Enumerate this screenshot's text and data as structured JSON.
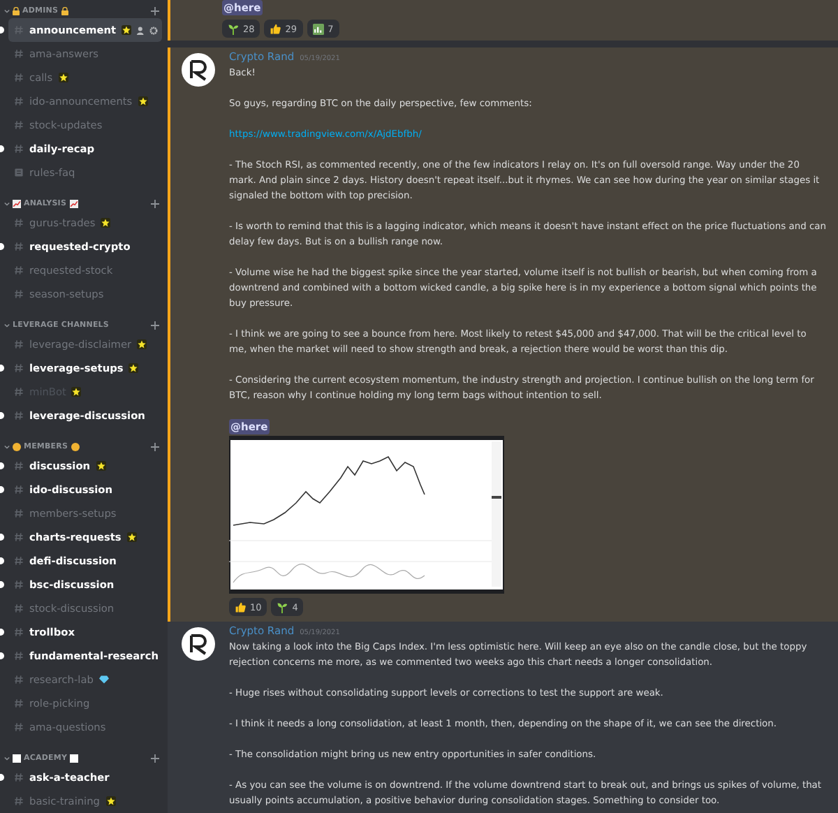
{
  "sidebar": {
    "categories": [
      {
        "name": "ADMINS",
        "kind": "lock",
        "expanded": true,
        "channels": [
          {
            "name": "announcement",
            "kind": "text",
            "unread": true,
            "selected": true,
            "muted": false,
            "starred": true
          },
          {
            "name": "ama-answers",
            "kind": "text",
            "unread": false,
            "selected": false,
            "muted": false
          },
          {
            "name": "calls",
            "kind": "text",
            "unread": false,
            "selected": false,
            "muted": false,
            "starred": true
          },
          {
            "name": "ido-announcements",
            "kind": "text",
            "unread": false,
            "selected": false,
            "muted": false,
            "starred": true
          },
          {
            "name": "stock-updates",
            "kind": "text",
            "unread": false,
            "selected": false,
            "muted": false
          },
          {
            "name": "daily-recap",
            "kind": "text",
            "unread": true,
            "selected": false,
            "muted": false
          },
          {
            "name": "rules-faq",
            "kind": "rules",
            "unread": false,
            "selected": false,
            "muted": false
          }
        ]
      },
      {
        "name": "ANALYSIS",
        "kind": "chart",
        "expanded": true,
        "channels": [
          {
            "name": "gurus-trades",
            "kind": "text",
            "unread": false,
            "selected": false,
            "muted": false,
            "starred": true
          },
          {
            "name": "requested-crypto",
            "kind": "text",
            "unread": true,
            "selected": false,
            "muted": false
          },
          {
            "name": "requested-stock",
            "kind": "text",
            "unread": false,
            "selected": false,
            "muted": false
          },
          {
            "name": "season-setups",
            "kind": "text",
            "unread": false,
            "selected": false,
            "muted": false
          }
        ]
      },
      {
        "name": "LEVERAGE CHANNELS",
        "kind": "plain",
        "expanded": true,
        "channels": [
          {
            "name": "leverage-disclaimer",
            "kind": "text",
            "unread": false,
            "selected": false,
            "muted": false,
            "starred": true
          },
          {
            "name": "leverage-setups",
            "kind": "text",
            "unread": true,
            "selected": false,
            "muted": false,
            "starred": true
          },
          {
            "name": "minBot",
            "kind": "text",
            "unread": false,
            "selected": false,
            "muted": true,
            "starred": true
          },
          {
            "name": "leverage-discussion",
            "kind": "text",
            "unread": true,
            "selected": false,
            "muted": false
          }
        ]
      },
      {
        "name": "MEMBERS",
        "kind": "coin",
        "expanded": true,
        "channels": [
          {
            "name": "discussion",
            "kind": "text",
            "unread": true,
            "selected": false,
            "muted": false,
            "starred": true
          },
          {
            "name": "ido-discussion",
            "kind": "text",
            "unread": true,
            "selected": false,
            "muted": false
          },
          {
            "name": "members-setups",
            "kind": "text",
            "unread": false,
            "selected": false,
            "muted": false
          },
          {
            "name": "charts-requests",
            "kind": "text",
            "unread": true,
            "selected": false,
            "muted": false,
            "starred": true
          },
          {
            "name": "defi-discussion",
            "kind": "text",
            "unread": true,
            "selected": false,
            "muted": false
          },
          {
            "name": "bsc-discussion",
            "kind": "text",
            "unread": true,
            "selected": false,
            "muted": false
          },
          {
            "name": "stock-discussion",
            "kind": "text",
            "unread": false,
            "selected": false,
            "muted": false
          },
          {
            "name": "trollbox",
            "kind": "text",
            "unread": true,
            "selected": false,
            "muted": false
          },
          {
            "name": "fundamental-research",
            "kind": "text",
            "unread": true,
            "selected": false,
            "muted": false
          },
          {
            "name": "research-lab",
            "kind": "text",
            "unread": false,
            "selected": false,
            "muted": false,
            "gem": true
          },
          {
            "name": "role-picking",
            "kind": "text",
            "unread": false,
            "selected": false,
            "muted": false
          },
          {
            "name": "ama-questions",
            "kind": "text",
            "unread": false,
            "selected": false,
            "muted": false
          }
        ]
      },
      {
        "name": "ACADEMY",
        "kind": "square",
        "expanded": true,
        "channels": [
          {
            "name": "ask-a-teacher",
            "kind": "text",
            "unread": true,
            "selected": false,
            "muted": false
          },
          {
            "name": "basic-training",
            "kind": "text",
            "unread": false,
            "selected": false,
            "muted": false,
            "starred": true
          }
        ]
      }
    ]
  },
  "messages": [
    {
      "kind": "continuation",
      "highlighted": true,
      "mention": "@here",
      "reactions": [
        {
          "kind": "sprout",
          "count": "28"
        },
        {
          "kind": "thumbs",
          "count": "29"
        },
        {
          "kind": "chart",
          "count": "7"
        }
      ]
    },
    {
      "kind": "full",
      "highlighted": true,
      "author": "Crypto Rand",
      "timestamp": "05/19/2021",
      "paragraphs": [
        {
          "kind": "text",
          "text": "Back!"
        },
        {
          "kind": "text",
          "text": "So guys, regarding BTC on the daily perspective, few comments:"
        },
        {
          "kind": "link",
          "text": "https://www.tradingview.com/x/AjdEbfbh/"
        },
        {
          "kind": "text",
          "text": "- The Stoch RSI, as commented recently, one of the few indicators I relay on. It's on full oversold range. Way under the 20 mark. And plain since 2 days. History doesn't repeat itself...but it rhymes. We can see how during the year on similar stages it signaled the bottom with top precision."
        },
        {
          "kind": "text",
          "text": "- Is worth to remind that this is a lagging indicator, which means it doesn't have instant effect on the price fluctuations and can delay few days. But is on a bullish range now."
        },
        {
          "kind": "text",
          "text": "- Volume wise he had the biggest spike since the year started, volume itself is not bullish or bearish, but when coming from a downtrend and combined with a bottom wicked candle, a big spike here is in my experience a bottom signal which points the buy pressure."
        },
        {
          "kind": "text",
          "text": "- I think we are going to see a bounce from here. Most likely to retest $45,000 and $47,000. That will be the critical level to me, when the market will need to show strength and break, a rejection there would be worst than this dip."
        },
        {
          "kind": "text",
          "text": "- Considering the current ecosystem momentum, the industry strength and projection. I continue bullish on the long term for BTC, reason why I continue holding  my long term bags without intention to sell."
        }
      ],
      "mention": "@here",
      "attachment": {
        "kind": "picture"
      },
      "reactions": [
        {
          "kind": "thumbs",
          "count": "10"
        },
        {
          "kind": "sprout",
          "count": "4"
        }
      ]
    },
    {
      "kind": "full",
      "highlighted": false,
      "author": "Crypto Rand",
      "timestamp": "05/19/2021",
      "paragraphs": [
        {
          "kind": "text",
          "text": "Now taking a look into the Big Caps Index. I'm less optimistic here. Will keep an eye also on the candle close, but the toppy rejection concerns me more, as we commented two weeks ago this chart needs a longer consolidation."
        },
        {
          "kind": "text",
          "text": "- Huge rises without consolidating support levels or corrections to test the support are weak."
        },
        {
          "kind": "text",
          "text": "- I think it needs a long consolidation, at least 1 month, then, depending on the shape of it, we can see the direction."
        },
        {
          "kind": "text",
          "text": "- The consolidation might bring us new entry opportunities in safer conditions."
        },
        {
          "kind": "text",
          "text": "- As you can see the volume is on downtrend. If the volume downtrend start to break out, and brings us spikes of volume, that usually points accumulation, a positive behavior during consolidation stages. Something to consider too."
        }
      ]
    }
  ]
}
